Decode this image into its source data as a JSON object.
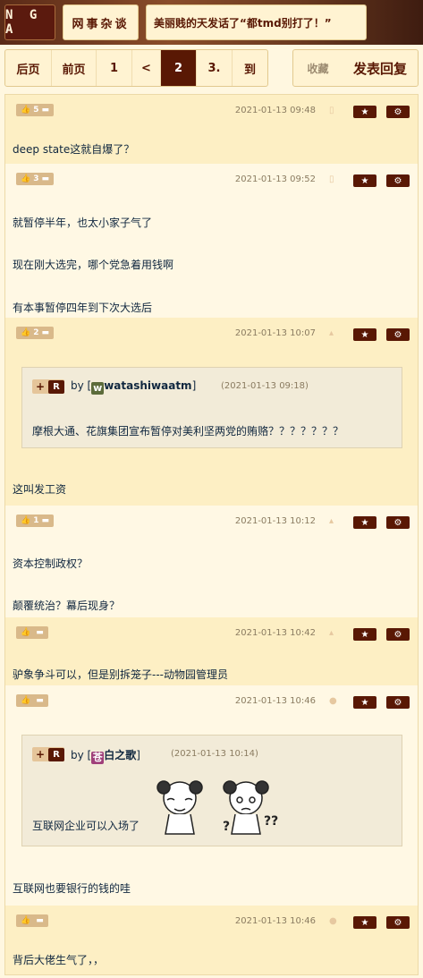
{
  "header": {
    "logo": "N G A",
    "forum": "网事杂谈",
    "topic": "美丽贱的天发话了“都tmd别打了！”"
  },
  "pager": {
    "items": [
      "后页",
      "前页",
      "1",
      "<",
      "2",
      "3.",
      "到"
    ],
    "active_index": 4
  },
  "actions": {
    "favorite": "收藏",
    "reply": "发表回复"
  },
  "posts": [
    {
      "votes": "5",
      "time": "2021-01-13 09:48",
      "lines": [
        "deep state这就自爆了？"
      ]
    },
    {
      "votes": "3",
      "time": "2021-01-13 09:52",
      "lines": [
        "就暂停半年，也太小家子气了",
        "现在刚大选完，哪个党急着用钱啊",
        "有本事暂停四年到下次大选后"
      ]
    },
    {
      "votes": "2",
      "time": "2021-01-13 10:07",
      "quote": {
        "by": "by",
        "avatar_letter": "w",
        "name": "watashiwaatm",
        "time": "(2021-01-13 09:18)",
        "text": "摩根大通、花旗集团宣布暂停对美利坚两党的贿赂？？？？？？？"
      },
      "lines": [
        "这叫发工资"
      ]
    },
    {
      "votes": "1",
      "time": "2021-01-13 10:12",
      "lines": [
        "资本控制政权？",
        "颠覆统治？幕后现身？"
      ]
    },
    {
      "votes": "",
      "time": "2021-01-13 10:42",
      "lines": [
        "驴象争斗可以，但是别拆笼子---动物园管理员"
      ]
    },
    {
      "votes": "",
      "time": "2021-01-13 10:46",
      "quote": {
        "by": "by",
        "avatar_letter": "苍",
        "name": "白之歌",
        "time": "(2021-01-13 10:14)",
        "text": "互联网企业可以入场了"
      },
      "lines": [
        "互联网也要银行的钱的哇"
      ]
    },
    {
      "votes": "",
      "time": "2021-01-13 10:46",
      "lines": [
        "背后大佬生气了，，"
      ]
    }
  ],
  "quote_tag": {
    "plus": "+",
    "r": "R"
  },
  "icons": {
    "star": "star-icon",
    "gear": "gear-icon",
    "thumb": "thumb-icon"
  },
  "colors": {
    "brand": "#591804",
    "bg": "#fff7e0",
    "post_alt": "#fdefc4"
  }
}
